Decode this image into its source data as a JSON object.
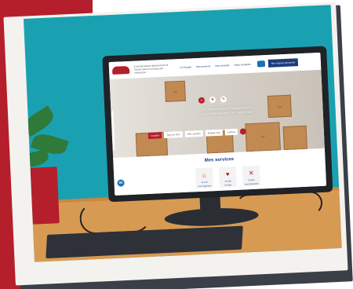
{
  "site": {
    "tagline": "Commercialisez déplacement de l'Ouest dans le ménage des entreprises"
  },
  "nav": {
    "items": [
      "Le Groupe",
      "Nos services",
      "Nos conseils",
      "Nous contacter"
    ],
    "account_label": "Mon espace personnel"
  },
  "hero": {
    "headline_line1": "Je veux changer également",
    "headline_line2": "que les démarches se simplifient",
    "filters": [
      "Location",
      "Type de bien",
      "Ville, quartier",
      "Budget max",
      "Surface"
    ]
  },
  "services": {
    "title": "Mes services",
    "items": [
      {
        "label": "Je loue",
        "sub": "mon logement"
      },
      {
        "label": "Je paie",
        "sub": "en ligne"
      },
      {
        "label": "Je gère",
        "sub": "mes demandes"
      }
    ]
  },
  "colors": {
    "brand_red": "#b41f2b",
    "brand_blue": "#1a3d7c",
    "teal": "#1aa1b1",
    "desk": "#d79a52"
  },
  "icons": [
    "search-icon",
    "chat-icon",
    "home-icon",
    "heart-icon",
    "tools-icon"
  ]
}
